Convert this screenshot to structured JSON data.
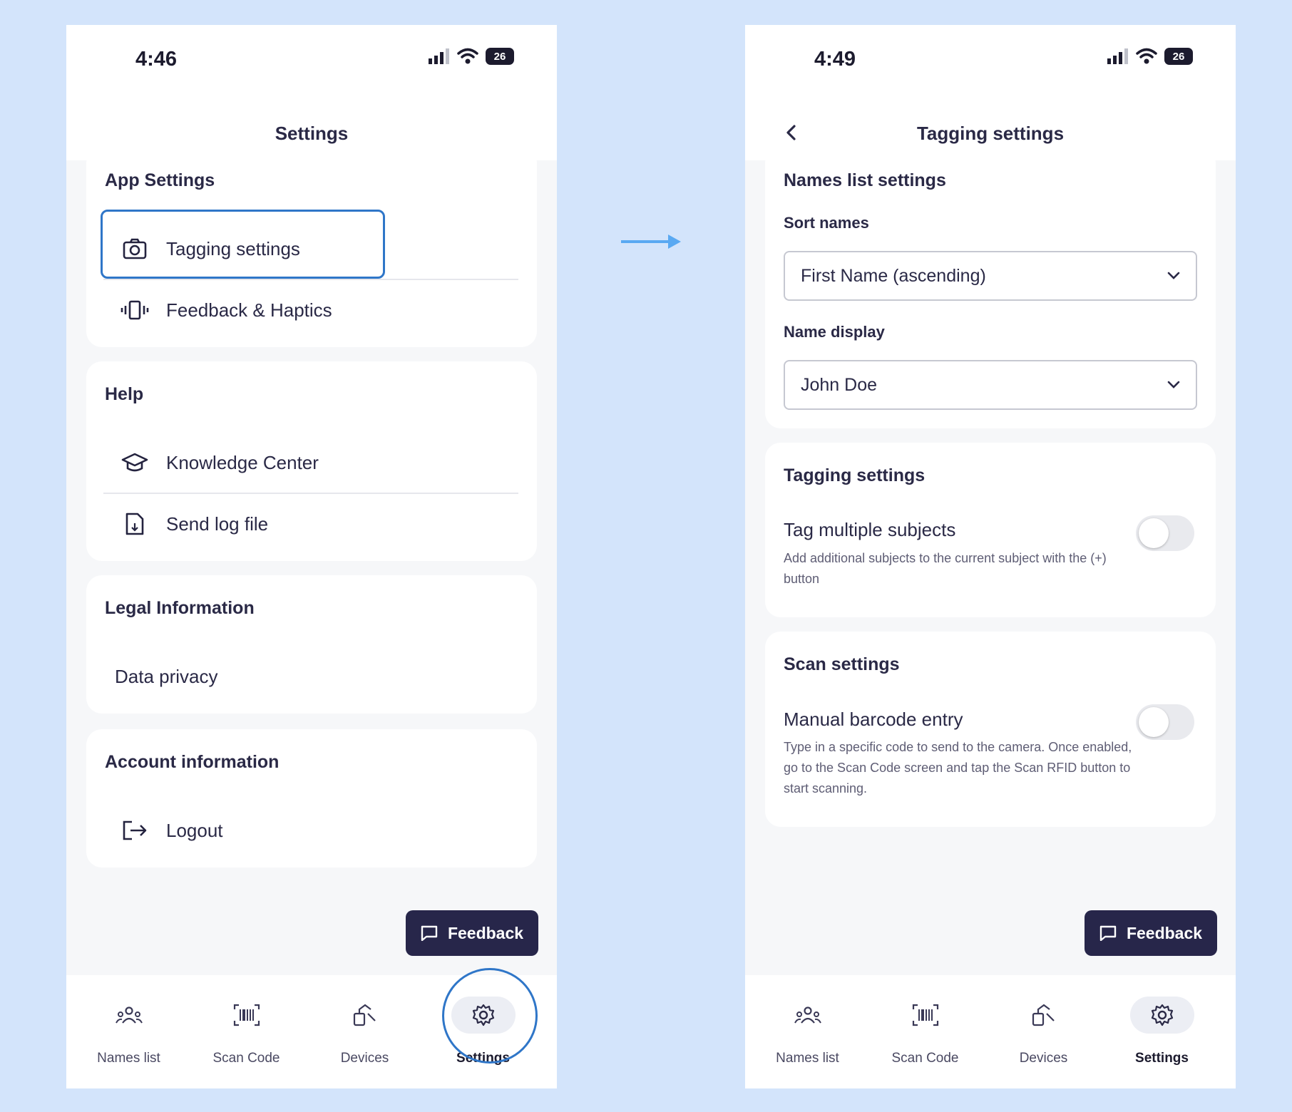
{
  "left_screen": {
    "status": {
      "time": "4:46",
      "battery": "26"
    },
    "header": {
      "title": "Settings"
    },
    "app_settings": {
      "title": "App Settings",
      "items": [
        {
          "label": "Tagging settings",
          "icon": "camera-icon"
        },
        {
          "label": "Feedback & Haptics",
          "icon": "vibration-icon"
        }
      ]
    },
    "help": {
      "title": "Help",
      "items": [
        {
          "label": "Knowledge Center",
          "icon": "graduation-cap-icon"
        },
        {
          "label": "Send log file",
          "icon": "file-icon"
        }
      ]
    },
    "legal": {
      "title": "Legal Information",
      "items": [
        {
          "label": "Data privacy"
        }
      ]
    },
    "account": {
      "title": "Account information",
      "items": [
        {
          "label": "Logout",
          "icon": "logout-icon"
        }
      ]
    },
    "feedback_button": "Feedback",
    "tabs": [
      {
        "label": "Names list",
        "icon": "people-icon"
      },
      {
        "label": "Scan Code",
        "icon": "barcode-icon"
      },
      {
        "label": "Devices",
        "icon": "devices-icon"
      },
      {
        "label": "Settings",
        "icon": "gear-icon",
        "active": true
      }
    ]
  },
  "right_screen": {
    "status": {
      "time": "4:49",
      "battery": "26"
    },
    "header": {
      "title": "Tagging settings"
    },
    "names_list_settings": {
      "title": "Names list settings",
      "sort_names": {
        "label": "Sort names",
        "value": "First Name (ascending)"
      },
      "name_display": {
        "label": "Name display",
        "value": "John Doe"
      }
    },
    "tagging_settings": {
      "title": "Tagging settings",
      "tag_multiple": {
        "label": "Tag multiple subjects",
        "description": "Add additional subjects to the current subject with the (+) button",
        "enabled": false
      }
    },
    "scan_settings": {
      "title": "Scan settings",
      "manual_barcode": {
        "label": "Manual barcode entry",
        "description": "Type in a specific code to send to the camera. Once enabled, go to the Scan Code screen and tap the Scan RFID button to start scanning.",
        "enabled": false
      }
    },
    "feedback_button": "Feedback",
    "tabs": [
      {
        "label": "Names list",
        "icon": "people-icon"
      },
      {
        "label": "Scan Code",
        "icon": "barcode-icon"
      },
      {
        "label": "Devices",
        "icon": "devices-icon"
      },
      {
        "label": "Settings",
        "icon": "gear-icon",
        "active": true
      }
    ]
  },
  "colors": {
    "background": "#d3e4fb",
    "accent": "#2f76c8",
    "feedback_button": "#27264a",
    "arrow": "#5aa9f2"
  }
}
